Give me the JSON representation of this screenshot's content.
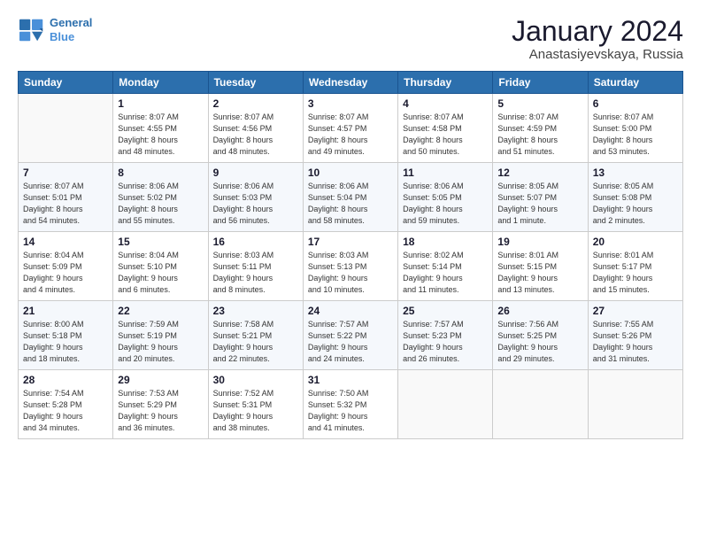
{
  "logo": {
    "line1": "General",
    "line2": "Blue"
  },
  "header": {
    "month": "January 2024",
    "location": "Anastasiyevskaya, Russia"
  },
  "weekdays": [
    "Sunday",
    "Monday",
    "Tuesday",
    "Wednesday",
    "Thursday",
    "Friday",
    "Saturday"
  ],
  "weeks": [
    [
      {
        "day": "",
        "info": ""
      },
      {
        "day": "1",
        "info": "Sunrise: 8:07 AM\nSunset: 4:55 PM\nDaylight: 8 hours\nand 48 minutes."
      },
      {
        "day": "2",
        "info": "Sunrise: 8:07 AM\nSunset: 4:56 PM\nDaylight: 8 hours\nand 48 minutes."
      },
      {
        "day": "3",
        "info": "Sunrise: 8:07 AM\nSunset: 4:57 PM\nDaylight: 8 hours\nand 49 minutes."
      },
      {
        "day": "4",
        "info": "Sunrise: 8:07 AM\nSunset: 4:58 PM\nDaylight: 8 hours\nand 50 minutes."
      },
      {
        "day": "5",
        "info": "Sunrise: 8:07 AM\nSunset: 4:59 PM\nDaylight: 8 hours\nand 51 minutes."
      },
      {
        "day": "6",
        "info": "Sunrise: 8:07 AM\nSunset: 5:00 PM\nDaylight: 8 hours\nand 53 minutes."
      }
    ],
    [
      {
        "day": "7",
        "info": "Sunrise: 8:07 AM\nSunset: 5:01 PM\nDaylight: 8 hours\nand 54 minutes."
      },
      {
        "day": "8",
        "info": "Sunrise: 8:06 AM\nSunset: 5:02 PM\nDaylight: 8 hours\nand 55 minutes."
      },
      {
        "day": "9",
        "info": "Sunrise: 8:06 AM\nSunset: 5:03 PM\nDaylight: 8 hours\nand 56 minutes."
      },
      {
        "day": "10",
        "info": "Sunrise: 8:06 AM\nSunset: 5:04 PM\nDaylight: 8 hours\nand 58 minutes."
      },
      {
        "day": "11",
        "info": "Sunrise: 8:06 AM\nSunset: 5:05 PM\nDaylight: 8 hours\nand 59 minutes."
      },
      {
        "day": "12",
        "info": "Sunrise: 8:05 AM\nSunset: 5:07 PM\nDaylight: 9 hours\nand 1 minute."
      },
      {
        "day": "13",
        "info": "Sunrise: 8:05 AM\nSunset: 5:08 PM\nDaylight: 9 hours\nand 2 minutes."
      }
    ],
    [
      {
        "day": "14",
        "info": "Sunrise: 8:04 AM\nSunset: 5:09 PM\nDaylight: 9 hours\nand 4 minutes."
      },
      {
        "day": "15",
        "info": "Sunrise: 8:04 AM\nSunset: 5:10 PM\nDaylight: 9 hours\nand 6 minutes."
      },
      {
        "day": "16",
        "info": "Sunrise: 8:03 AM\nSunset: 5:11 PM\nDaylight: 9 hours\nand 8 minutes."
      },
      {
        "day": "17",
        "info": "Sunrise: 8:03 AM\nSunset: 5:13 PM\nDaylight: 9 hours\nand 10 minutes."
      },
      {
        "day": "18",
        "info": "Sunrise: 8:02 AM\nSunset: 5:14 PM\nDaylight: 9 hours\nand 11 minutes."
      },
      {
        "day": "19",
        "info": "Sunrise: 8:01 AM\nSunset: 5:15 PM\nDaylight: 9 hours\nand 13 minutes."
      },
      {
        "day": "20",
        "info": "Sunrise: 8:01 AM\nSunset: 5:17 PM\nDaylight: 9 hours\nand 15 minutes."
      }
    ],
    [
      {
        "day": "21",
        "info": "Sunrise: 8:00 AM\nSunset: 5:18 PM\nDaylight: 9 hours\nand 18 minutes."
      },
      {
        "day": "22",
        "info": "Sunrise: 7:59 AM\nSunset: 5:19 PM\nDaylight: 9 hours\nand 20 minutes."
      },
      {
        "day": "23",
        "info": "Sunrise: 7:58 AM\nSunset: 5:21 PM\nDaylight: 9 hours\nand 22 minutes."
      },
      {
        "day": "24",
        "info": "Sunrise: 7:57 AM\nSunset: 5:22 PM\nDaylight: 9 hours\nand 24 minutes."
      },
      {
        "day": "25",
        "info": "Sunrise: 7:57 AM\nSunset: 5:23 PM\nDaylight: 9 hours\nand 26 minutes."
      },
      {
        "day": "26",
        "info": "Sunrise: 7:56 AM\nSunset: 5:25 PM\nDaylight: 9 hours\nand 29 minutes."
      },
      {
        "day": "27",
        "info": "Sunrise: 7:55 AM\nSunset: 5:26 PM\nDaylight: 9 hours\nand 31 minutes."
      }
    ],
    [
      {
        "day": "28",
        "info": "Sunrise: 7:54 AM\nSunset: 5:28 PM\nDaylight: 9 hours\nand 34 minutes."
      },
      {
        "day": "29",
        "info": "Sunrise: 7:53 AM\nSunset: 5:29 PM\nDaylight: 9 hours\nand 36 minutes."
      },
      {
        "day": "30",
        "info": "Sunrise: 7:52 AM\nSunset: 5:31 PM\nDaylight: 9 hours\nand 38 minutes."
      },
      {
        "day": "31",
        "info": "Sunrise: 7:50 AM\nSunset: 5:32 PM\nDaylight: 9 hours\nand 41 minutes."
      },
      {
        "day": "",
        "info": ""
      },
      {
        "day": "",
        "info": ""
      },
      {
        "day": "",
        "info": ""
      }
    ]
  ]
}
